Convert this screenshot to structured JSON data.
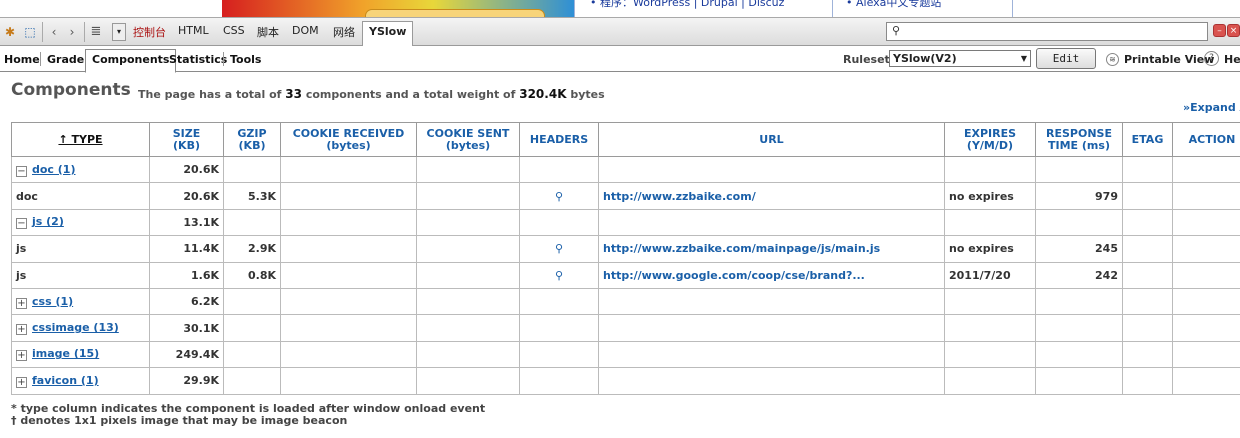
{
  "top_strip": {
    "link1": "• 程序：WordPress | Drupal | Discuz",
    "link2": "• Alexa中文专题站"
  },
  "toolbar": {
    "tabs": [
      "控制台",
      "HTML",
      "CSS",
      "脚本",
      "DOM",
      "网络",
      "YSlow"
    ],
    "active_tab": "YSlow",
    "search_placeholder": ""
  },
  "nav": {
    "tabs": [
      "Home",
      "Grade",
      "Components",
      "Statistics",
      "Tools"
    ],
    "active_tab": "Components",
    "rulesets_label": "Rulesets",
    "ruleset_value": "YSlow(V2)",
    "edit_label": "Edit",
    "printable_label": "Printable View",
    "help_label": "Hel"
  },
  "heading": {
    "title": "Components",
    "summary_pre": "The page has a total of",
    "count": "33",
    "summary_mid": "components and a total weight of",
    "weight": "320.4K",
    "summary_post": "bytes",
    "expand_all": "»Expand Al"
  },
  "table": {
    "columns": [
      {
        "label": "↑ TYPE",
        "sub": ""
      },
      {
        "label": "SIZE",
        "sub": "(KB)"
      },
      {
        "label": "GZIP",
        "sub": "(KB)"
      },
      {
        "label": "COOKIE RECEIVED",
        "sub": "(bytes)"
      },
      {
        "label": "COOKIE SENT",
        "sub": "(bytes)"
      },
      {
        "label": "HEADERS",
        "sub": ""
      },
      {
        "label": "URL",
        "sub": ""
      },
      {
        "label": "EXPIRES",
        "sub": "(Y/M/D)"
      },
      {
        "label": "RESPONSE",
        "sub": "TIME (ms)"
      },
      {
        "label": "ETAG",
        "sub": ""
      },
      {
        "label": "ACTION",
        "sub": ""
      }
    ],
    "rows": [
      {
        "kind": "group",
        "toggle": "−",
        "type": "doc (1)",
        "size": "20.6K"
      },
      {
        "kind": "item",
        "type": "doc",
        "size": "20.6K",
        "gzip": "5.3K",
        "headers": true,
        "url": "http://www.zzbaike.com/",
        "expires": "no expires",
        "response": "979"
      },
      {
        "kind": "group",
        "toggle": "−",
        "type": "js (2)",
        "size": "13.1K"
      },
      {
        "kind": "item",
        "type": "js",
        "size": "11.4K",
        "gzip": "2.9K",
        "headers": true,
        "url": "http://www.zzbaike.com/mainpage/js/main.js",
        "expires": "no expires",
        "response": "245"
      },
      {
        "kind": "item",
        "type": "js",
        "size": "1.6K",
        "gzip": "0.8K",
        "headers": true,
        "url": "http://www.google.com/coop/cse/brand?...",
        "expires": "2011/7/20",
        "response": "242"
      },
      {
        "kind": "group",
        "toggle": "+",
        "type": "css (1)",
        "size": "6.2K"
      },
      {
        "kind": "group",
        "toggle": "+",
        "type": "cssimage (13)",
        "size": "30.1K"
      },
      {
        "kind": "group",
        "toggle": "+",
        "type": "image (15)",
        "size": "249.4K"
      },
      {
        "kind": "group",
        "toggle": "+",
        "type": "favicon (1)",
        "size": "29.9K"
      }
    ]
  },
  "notes": [
    "* type column indicates the component is loaded after window onload event",
    "† denotes 1x1 pixels image that may be image beacon"
  ],
  "colors": {
    "link": "#1a5fa8",
    "header_text": "#1a5fa8",
    "accent_red": "#d9534f"
  },
  "icons": [
    "firebug-icon",
    "inspect-icon",
    "back-arrow-icon",
    "forward-arrow-icon",
    "menu-icon",
    "dropdown-icon",
    "search-icon",
    "close-icon",
    "print-icon",
    "help-icon",
    "magnifier-icon"
  ]
}
